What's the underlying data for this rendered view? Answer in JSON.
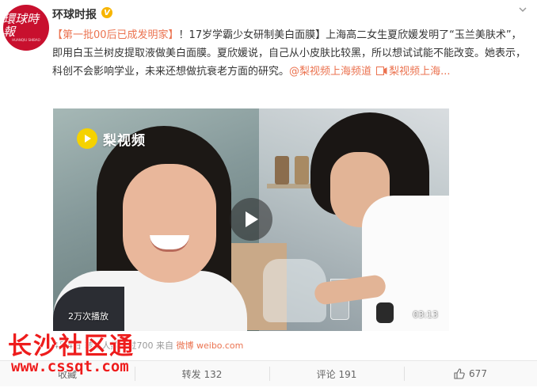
{
  "post": {
    "author": "环球时报",
    "verified_mark": "V",
    "avatar_text": "環球時報",
    "avatar_sub": "HUANQIU SHIBAO",
    "text_hashtag": "【第一批00后已成发明家】",
    "text_body": "！17岁学霸少女研制美白面膜】上海高二女生夏欣媛发明了“玉兰美肤术”，即用白玉兰树皮提取液做美白面膜。夏欣媛说，自己从小皮肤比较黑，所以想试试能不能改变。她表示，科创不会影响学业，未来还想做抗衰老方面的研究。",
    "text_link": "@梨视频上海频道",
    "text_video_link": "梨视频上海...",
    "icons": {
      "more": "chevron-down-icon",
      "video_link": "video-icon",
      "forward": "forward-icon",
      "comment": "comment-icon",
      "like": "thumb-up-icon"
    }
  },
  "video": {
    "logo_text": "梨视频",
    "views": "2万次播放",
    "duration": "03:13"
  },
  "meta": {
    "prefix": "",
    "text": "4月4日 转发人数超过700  来自",
    "source": "微博 weibo.com"
  },
  "watermark": {
    "cn": "长沙社区通",
    "url": "www.cssqt.com"
  },
  "actions": {
    "collect": "收藏",
    "forward": "转发 132",
    "comment": "评论 191",
    "like": "677"
  },
  "colors": {
    "accent": "#eb7350",
    "verified": "#f7b500",
    "watermark": "#ee1c1c"
  }
}
